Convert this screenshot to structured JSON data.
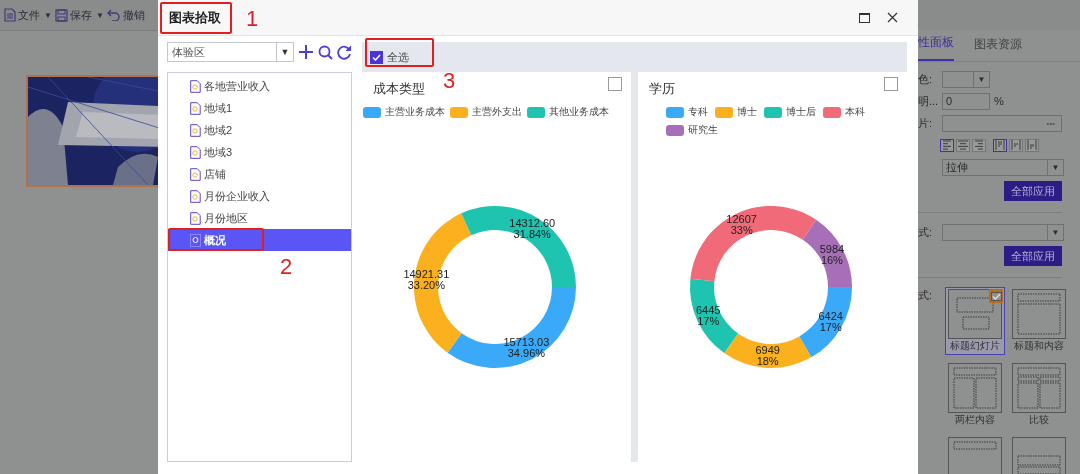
{
  "background_app": {
    "toolbar": [
      {
        "kind": "file",
        "label": "文件",
        "caret": "▼"
      },
      {
        "kind": "save",
        "label": "保存",
        "caret": "▼"
      },
      {
        "kind": "undo",
        "label": "撤销"
      }
    ],
    "property_panel": {
      "tabs": [
        {
          "label": "性面板",
          "selected": true
        },
        {
          "label": "图表资源",
          "selected": false
        }
      ],
      "rows": [
        {
          "kind": "color",
          "label": "色:",
          "caret": "▼"
        },
        {
          "kind": "number",
          "label": "明...",
          "value": "0",
          "unit": "%"
        },
        {
          "kind": "file",
          "label": "片:",
          "button": "•••"
        },
        {
          "kind": "align",
          "buttons": [
            {
              "kind": "left",
              "selected": true
            },
            {
              "kind": "center",
              "selected": false
            },
            {
              "kind": "right",
              "selected": false
            },
            {
              "kind": "top",
              "selected": true
            },
            {
              "kind": "middle",
              "selected": false
            },
            {
              "kind": "bottom",
              "selected": false
            }
          ]
        },
        {
          "kind": "select",
          "value": "拉伸",
          "caret": "▼"
        },
        {
          "kind": "button",
          "label": "全部应用"
        },
        {
          "kind": "divider"
        },
        {
          "kind": "select",
          "label": "式:",
          "caret": "▼"
        },
        {
          "kind": "button",
          "label": "全部应用"
        },
        {
          "kind": "divider"
        }
      ],
      "layouts_label": "式:",
      "layouts": [
        {
          "kind": "title",
          "label": "标题幻灯片",
          "selected": true
        },
        {
          "kind": "title-content",
          "label": "标题和内容",
          "selected": false
        },
        {
          "kind": "two-column",
          "label": "两栏内容",
          "selected": false
        },
        {
          "kind": "compare",
          "label": "比较",
          "selected": false
        },
        {
          "kind": "title-only",
          "selected": false
        },
        {
          "kind": "section",
          "selected": false
        }
      ]
    }
  },
  "dialog": {
    "title": "图表拾取",
    "dataset_select": {
      "value": "体验区",
      "caret": "▼"
    },
    "tree": [
      {
        "label": "各地营业收入",
        "selected": false
      },
      {
        "label": "地域1",
        "selected": false
      },
      {
        "label": "地域2",
        "selected": false
      },
      {
        "label": "地域3",
        "selected": false
      },
      {
        "label": "店铺",
        "selected": false
      },
      {
        "label": "月份企业收入",
        "selected": false
      },
      {
        "label": "月份地区",
        "selected": false
      },
      {
        "label": "概况",
        "selected": true
      }
    ],
    "select_all": {
      "label": "全选",
      "checked": true
    },
    "charts": [
      {
        "title": "成本类型",
        "checked": false,
        "chart_data": {
          "type": "donut",
          "categories": [
            "主营业务成本",
            "主营外支出",
            "其他业务成本"
          ],
          "values": [
            34.96,
            33.2,
            31.84
          ],
          "colors": [
            "#3aa9f8",
            "#fbb01d",
            "#1ec4b0"
          ],
          "value_labels": [
            [
              "15713.03",
              "34.96%"
            ],
            [
              "14921.31",
              "33.20%"
            ],
            [
              "14312.60",
              "31.84%"
            ]
          ]
        }
      },
      {
        "title": "学历",
        "checked": false,
        "chart_data": {
          "type": "donut",
          "categories": [
            "专科",
            "博士",
            "博士后",
            "本科",
            "研究生"
          ],
          "values": [
            16.73,
            18.09,
            16.78,
            32.82,
            15.58
          ],
          "colors": [
            "#3aa9f8",
            "#fbb01d",
            "#1ec4b0",
            "#f06a7a",
            "#a86fb9"
          ],
          "value_labels": [
            [
              "6424",
              "17%"
            ],
            [
              "6949",
              "18%"
            ],
            [
              "6445",
              "17%"
            ],
            [
              "12607",
              "33%"
            ],
            [
              "5984",
              "16%"
            ]
          ]
        }
      }
    ]
  },
  "annotations": [
    {
      "label": "1"
    },
    {
      "label": "2"
    },
    {
      "label": "3"
    }
  ]
}
